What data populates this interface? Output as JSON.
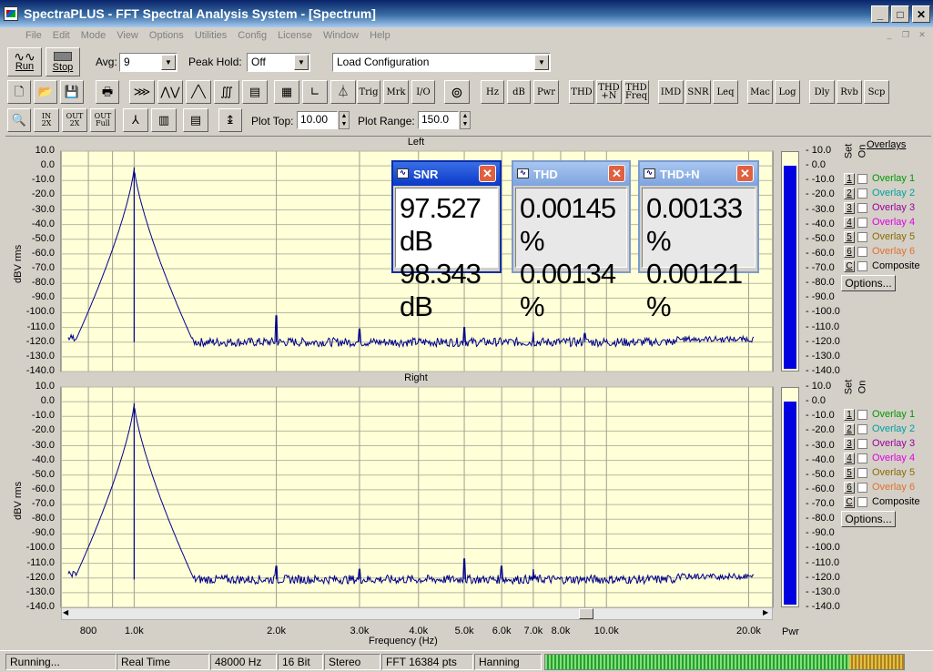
{
  "window": {
    "title": "SpectraPLUS - FFT Spectral Analysis System - [Spectrum]",
    "min": "_",
    "max": "□",
    "close": "✕"
  },
  "menu": [
    "File",
    "Edit",
    "Mode",
    "View",
    "Options",
    "Utilities",
    "Config",
    "License",
    "Window",
    "Help"
  ],
  "toolbar1": {
    "run": "Run",
    "stop": "Stop",
    "avg_label": "Avg:",
    "avg_value": "9",
    "peak_label": "Peak Hold:",
    "peak_value": "Off",
    "config_value": "Load Configuration"
  },
  "toolbar2": [
    "Trig",
    "Mrk",
    "I/O",
    "Hz",
    "dB",
    "Pwr",
    "THD",
    "THD\n+N",
    "THD\nFreq",
    "IMD",
    "SNR",
    "Leq",
    "Mac",
    "Log",
    "Dly",
    "Rvb",
    "Scp"
  ],
  "toolbar3": {
    "zoom_in": "IN\n2X",
    "zoom_out": "OUT\n2X",
    "zoom_full": "OUT\nFull",
    "plot_top_label": "Plot Top:",
    "plot_top_value": "10.00",
    "plot_range_label": "Plot Range:",
    "plot_range_value": "150.0"
  },
  "chart_data": [
    {
      "type": "line",
      "title": "Left",
      "ylabel": "dBV rms",
      "xlabel": "Frequency (Hz)",
      "xscale": "log",
      "ylim": [
        -140,
        10
      ],
      "y_ticks": [
        "10.0",
        "0.0",
        "-10.0",
        "-20.0",
        "-30.0",
        "-40.0",
        "-50.0",
        "-60.0",
        "-70.0",
        "-80.0",
        "-90.0",
        "-100.0",
        "-110.0",
        "-120.0",
        "-130.0",
        "-140.0"
      ],
      "peaks": [
        {
          "x": 1000,
          "y": -1
        },
        {
          "x": 2000,
          "y": -102
        },
        {
          "x": 3000,
          "y": -111
        },
        {
          "x": 5000,
          "y": -110
        },
        {
          "x": 7000,
          "y": -113
        },
        {
          "x": 9000,
          "y": -114
        }
      ],
      "noise_floor": -120
    },
    {
      "type": "line",
      "title": "Right",
      "ylabel": "dBV rms",
      "xlabel": "Frequency (Hz)",
      "xscale": "log",
      "ylim": [
        -140,
        10
      ],
      "y_ticks": [
        "10.0",
        "0.0",
        "-10.0",
        "-20.0",
        "-30.0",
        "-40.0",
        "-50.0",
        "-60.0",
        "-70.0",
        "-80.0",
        "-90.0",
        "-100.0",
        "-110.0",
        "-120.0",
        "-130.0",
        "-140.0"
      ],
      "peaks": [
        {
          "x": 1000,
          "y": -1
        },
        {
          "x": 2000,
          "y": -112
        },
        {
          "x": 3000,
          "y": -114
        },
        {
          "x": 5000,
          "y": -107
        },
        {
          "x": 6000,
          "y": -112
        },
        {
          "x": 7000,
          "y": -114
        }
      ],
      "noise_floor": -121
    }
  ],
  "x_ticks": [
    "800",
    "1.0k",
    "2.0k",
    "3.0k",
    "4.0k",
    "5.0k",
    "6.0k",
    "7.0k",
    "8.0k",
    "10.0k",
    "20.0k"
  ],
  "x_tick_values": [
    800,
    1000,
    2000,
    3000,
    4000,
    5000,
    6000,
    7000,
    8000,
    10000,
    20000
  ],
  "xlabel": "Frequency (Hz)",
  "pwr_label": "Pwr",
  "meters": [
    {
      "level": 0.93
    },
    {
      "level": 0.93
    }
  ],
  "overlays": {
    "header": "Overlays",
    "set": "Set",
    "on": "On",
    "items": [
      {
        "n": "1",
        "label": "Overlay 1",
        "color": "#009900"
      },
      {
        "n": "2",
        "label": "Overlay 2",
        "color": "#00a0a0"
      },
      {
        "n": "3",
        "label": "Overlay 3",
        "color": "#990099"
      },
      {
        "n": "4",
        "label": "Overlay 4",
        "color": "#e000e0"
      },
      {
        "n": "5",
        "label": "Overlay 5",
        "color": "#8a6a00"
      },
      {
        "n": "6",
        "label": "Overlay 6",
        "color": "#e07030"
      },
      {
        "n": "C",
        "label": "Composite",
        "color": "#000000"
      }
    ],
    "options": "Options..."
  },
  "readouts": [
    {
      "title": "SNR",
      "v1": "97.527 dB",
      "v2": "98.343 dB"
    },
    {
      "title": "THD",
      "v1": "0.00145 %",
      "v2": "0.00134 %"
    },
    {
      "title": "THD+N",
      "v1": "0.00133 %",
      "v2": "0.00121 %"
    }
  ],
  "status": {
    "state": "Running...",
    "mode": "Real Time",
    "rate": "48000 Hz",
    "bits": "16 Bit",
    "channels": "Stereo",
    "fft": "FFT 16384 pts",
    "window": "Hanning"
  },
  "colors": {
    "trace": "#00008b",
    "plot_bg": "#ffffd8",
    "meter": "#0000e0"
  }
}
